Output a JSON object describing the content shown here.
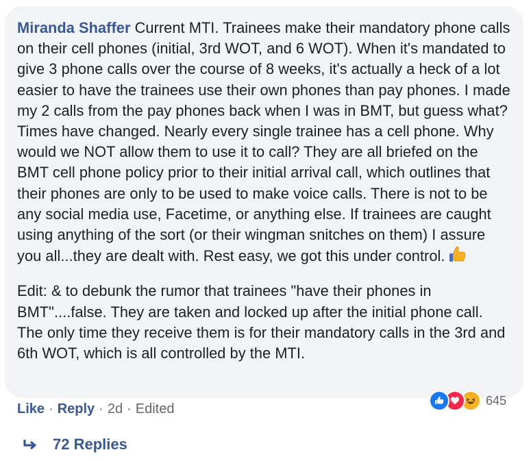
{
  "comment": {
    "author": "Miranda Shaffer",
    "paragraphs": [
      "Current MTI. Trainees make their mandatory phone calls on their cell phones (initial, 3rd WOT, and 6 WOT). When it's mandated to give 3 phone calls over the course of 8 weeks, it's actually a heck of a lot easier to have the trainees use their own phones than pay phones. I made my 2 calls from the pay phones back when I was in BMT, but guess what? Times have changed. Nearly every single trainee has a cell phone. Why would we NOT allow them to use it to call? They are all briefed on the BMT cell phone policy prior to their initial arrival call, which outlines that their phones are only to be used to make voice calls. There is not to be any social media use, Facetime, or anything else. If trainees are caught using anything of the sort (or their wingman snitches on them) I assure you all...they are dealt with. Rest easy, we got this under control.",
      "Edit: & to debunk the rumor that trainees \"have their phones in BMT\"....false. They are taken and locked up after the initial phone call. The only time they receive them is for their mandatory calls in the 3rd and 6th WOT, which is all controlled by the MTI."
    ],
    "emoji": "thumbs-up-icon",
    "reactions": {
      "icons": [
        "like-icon",
        "love-icon",
        "haha-icon"
      ],
      "count": "645"
    },
    "actions": {
      "like": "Like",
      "reply": "Reply",
      "separator": "·",
      "time": "2d",
      "edited": "Edited"
    },
    "replies_label": "72 Replies"
  },
  "colors": {
    "bubble": "#f2f3f5",
    "text": "#1c1e21",
    "link": "#385898",
    "meta": "#65676b",
    "like": "#1877f2",
    "love": "#f0284a",
    "haha": "#f7b125"
  }
}
